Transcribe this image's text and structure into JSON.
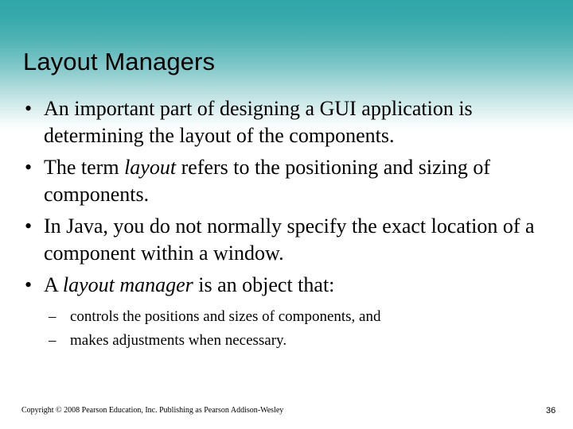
{
  "slide": {
    "title": "Layout Managers",
    "page_number": "36",
    "background": {
      "gradient_top_color": "#31a7aa",
      "gradient_bottom_color": "#ffffff"
    },
    "bullet_glyph": "•",
    "sub_bullet_glyph": "–"
  },
  "bullets": [
    {
      "pre": "An important part of designing a GUI application is determining the layout of the components.",
      "italic": "",
      "post": ""
    },
    {
      "pre": "The term ",
      "italic": "layout",
      "post": " refers to the positioning and sizing of components."
    },
    {
      "pre": "In Java, you do not normally specify the exact location of a component within a window.",
      "italic": "",
      "post": ""
    },
    {
      "pre": "A ",
      "italic": "layout manager",
      "post": " is an object that:"
    }
  ],
  "sub_bullets": [
    {
      "text": "controls the positions and sizes of components, and"
    },
    {
      "text": "makes adjustments when necessary."
    }
  ],
  "footer": {
    "copyright": "Copyright © 2008 Pearson Education, Inc. Publishing as Pearson Addison-Wesley"
  }
}
